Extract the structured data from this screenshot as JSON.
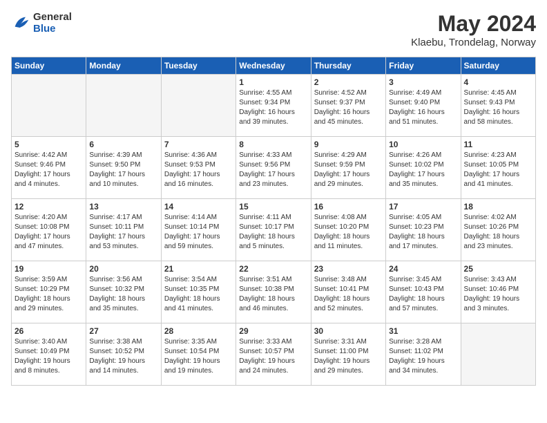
{
  "header": {
    "logo_general": "General",
    "logo_blue": "Blue",
    "month_title": "May 2024",
    "location": "Klaebu, Trondelag, Norway"
  },
  "days_of_week": [
    "Sunday",
    "Monday",
    "Tuesday",
    "Wednesday",
    "Thursday",
    "Friday",
    "Saturday"
  ],
  "weeks": [
    [
      {
        "day": "",
        "info": ""
      },
      {
        "day": "",
        "info": ""
      },
      {
        "day": "",
        "info": ""
      },
      {
        "day": "1",
        "info": "Sunrise: 4:55 AM\nSunset: 9:34 PM\nDaylight: 16 hours\nand 39 minutes."
      },
      {
        "day": "2",
        "info": "Sunrise: 4:52 AM\nSunset: 9:37 PM\nDaylight: 16 hours\nand 45 minutes."
      },
      {
        "day": "3",
        "info": "Sunrise: 4:49 AM\nSunset: 9:40 PM\nDaylight: 16 hours\nand 51 minutes."
      },
      {
        "day": "4",
        "info": "Sunrise: 4:45 AM\nSunset: 9:43 PM\nDaylight: 16 hours\nand 58 minutes."
      }
    ],
    [
      {
        "day": "5",
        "info": "Sunrise: 4:42 AM\nSunset: 9:46 PM\nDaylight: 17 hours\nand 4 minutes."
      },
      {
        "day": "6",
        "info": "Sunrise: 4:39 AM\nSunset: 9:50 PM\nDaylight: 17 hours\nand 10 minutes."
      },
      {
        "day": "7",
        "info": "Sunrise: 4:36 AM\nSunset: 9:53 PM\nDaylight: 17 hours\nand 16 minutes."
      },
      {
        "day": "8",
        "info": "Sunrise: 4:33 AM\nSunset: 9:56 PM\nDaylight: 17 hours\nand 23 minutes."
      },
      {
        "day": "9",
        "info": "Sunrise: 4:29 AM\nSunset: 9:59 PM\nDaylight: 17 hours\nand 29 minutes."
      },
      {
        "day": "10",
        "info": "Sunrise: 4:26 AM\nSunset: 10:02 PM\nDaylight: 17 hours\nand 35 minutes."
      },
      {
        "day": "11",
        "info": "Sunrise: 4:23 AM\nSunset: 10:05 PM\nDaylight: 17 hours\nand 41 minutes."
      }
    ],
    [
      {
        "day": "12",
        "info": "Sunrise: 4:20 AM\nSunset: 10:08 PM\nDaylight: 17 hours\nand 47 minutes."
      },
      {
        "day": "13",
        "info": "Sunrise: 4:17 AM\nSunset: 10:11 PM\nDaylight: 17 hours\nand 53 minutes."
      },
      {
        "day": "14",
        "info": "Sunrise: 4:14 AM\nSunset: 10:14 PM\nDaylight: 17 hours\nand 59 minutes."
      },
      {
        "day": "15",
        "info": "Sunrise: 4:11 AM\nSunset: 10:17 PM\nDaylight: 18 hours\nand 5 minutes."
      },
      {
        "day": "16",
        "info": "Sunrise: 4:08 AM\nSunset: 10:20 PM\nDaylight: 18 hours\nand 11 minutes."
      },
      {
        "day": "17",
        "info": "Sunrise: 4:05 AM\nSunset: 10:23 PM\nDaylight: 18 hours\nand 17 minutes."
      },
      {
        "day": "18",
        "info": "Sunrise: 4:02 AM\nSunset: 10:26 PM\nDaylight: 18 hours\nand 23 minutes."
      }
    ],
    [
      {
        "day": "19",
        "info": "Sunrise: 3:59 AM\nSunset: 10:29 PM\nDaylight: 18 hours\nand 29 minutes."
      },
      {
        "day": "20",
        "info": "Sunrise: 3:56 AM\nSunset: 10:32 PM\nDaylight: 18 hours\nand 35 minutes."
      },
      {
        "day": "21",
        "info": "Sunrise: 3:54 AM\nSunset: 10:35 PM\nDaylight: 18 hours\nand 41 minutes."
      },
      {
        "day": "22",
        "info": "Sunrise: 3:51 AM\nSunset: 10:38 PM\nDaylight: 18 hours\nand 46 minutes."
      },
      {
        "day": "23",
        "info": "Sunrise: 3:48 AM\nSunset: 10:41 PM\nDaylight: 18 hours\nand 52 minutes."
      },
      {
        "day": "24",
        "info": "Sunrise: 3:45 AM\nSunset: 10:43 PM\nDaylight: 18 hours\nand 57 minutes."
      },
      {
        "day": "25",
        "info": "Sunrise: 3:43 AM\nSunset: 10:46 PM\nDaylight: 19 hours\nand 3 minutes."
      }
    ],
    [
      {
        "day": "26",
        "info": "Sunrise: 3:40 AM\nSunset: 10:49 PM\nDaylight: 19 hours\nand 8 minutes."
      },
      {
        "day": "27",
        "info": "Sunrise: 3:38 AM\nSunset: 10:52 PM\nDaylight: 19 hours\nand 14 minutes."
      },
      {
        "day": "28",
        "info": "Sunrise: 3:35 AM\nSunset: 10:54 PM\nDaylight: 19 hours\nand 19 minutes."
      },
      {
        "day": "29",
        "info": "Sunrise: 3:33 AM\nSunset: 10:57 PM\nDaylight: 19 hours\nand 24 minutes."
      },
      {
        "day": "30",
        "info": "Sunrise: 3:31 AM\nSunset: 11:00 PM\nDaylight: 19 hours\nand 29 minutes."
      },
      {
        "day": "31",
        "info": "Sunrise: 3:28 AM\nSunset: 11:02 PM\nDaylight: 19 hours\nand 34 minutes."
      },
      {
        "day": "",
        "info": ""
      }
    ]
  ]
}
